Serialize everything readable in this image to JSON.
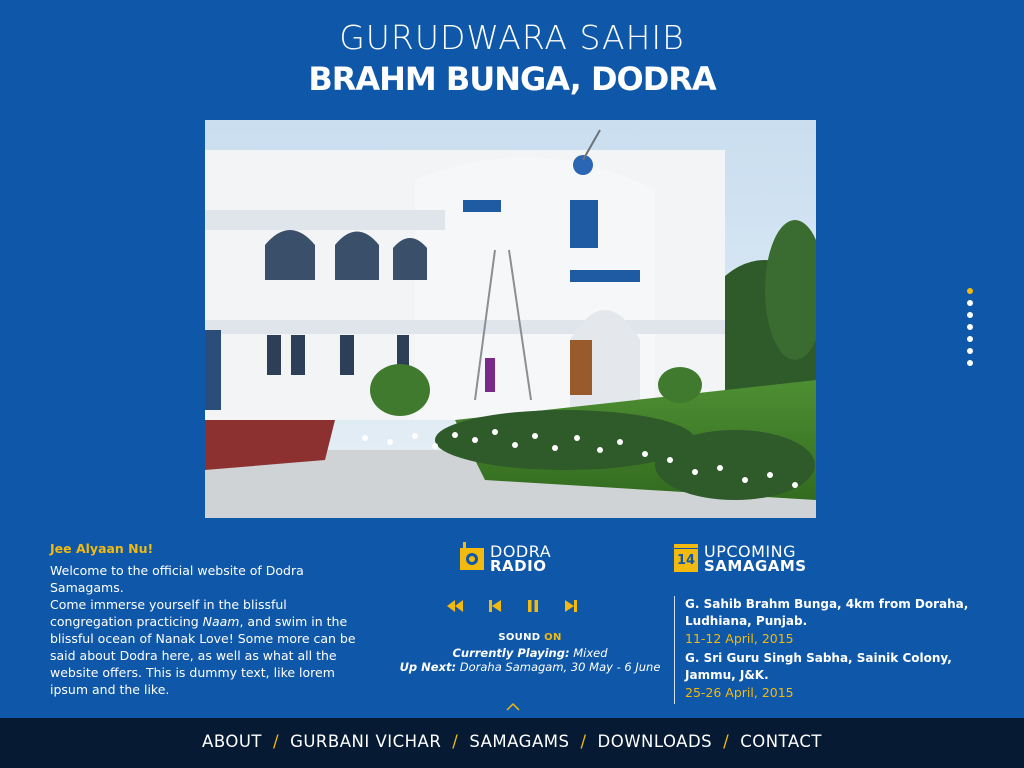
{
  "header": {
    "title_line1": "GURUDWARA SAHIB",
    "title_line2": "BRAHM BUNGA, DODRA"
  },
  "colors": {
    "background": "#0f57a8",
    "accent": "#f2b90f",
    "navbar": "#061a33"
  },
  "slider": {
    "dot_count": 7,
    "active_index": 0
  },
  "welcome": {
    "heading": "Jee Alyaan Nu!",
    "line1": "Welcome to the official website of Dodra Samagams.",
    "line2_a": "Come immerse yourself in the blissful congregation practicing ",
    "line2_em": "Naam",
    "line2_b": ", and swim in the blissful ocean of Nanak Love! Some more can be said about Dodra here, as well as what all the website offers. This is dummy text, like lorem ipsum and the like."
  },
  "radio": {
    "title_line1": "DODRA",
    "title_line2": "RADIO",
    "icons": [
      "rewind-icon",
      "previous-icon",
      "pause-icon",
      "next-icon"
    ],
    "sound_label": "SOUND",
    "sound_state": "ON",
    "playing_label": "Currently Playing:",
    "playing_value": "Mixed",
    "next_label": "Up Next:",
    "next_value": "Doraha Samagam, 30 May - 6 June"
  },
  "upcoming": {
    "calendar_number": "14",
    "title_line1": "UPCOMING",
    "title_line2": "SAMAGAMS",
    "events": [
      {
        "name": "G. Sahib Brahm Bunga, 4km from Doraha, Ludhiana, Punjab.",
        "date": "11-12 April, 2015"
      },
      {
        "name": "G. Sri Guru Singh Sabha, Sainik Colony, Jammu, J&K.",
        "date": "25-26 April, 2015"
      }
    ]
  },
  "nav": {
    "items": [
      "ABOUT",
      "GURBANI VICHAR",
      "SAMAGAMS",
      "DOWNLOADS",
      "CONTACT"
    ],
    "separator": "/"
  }
}
